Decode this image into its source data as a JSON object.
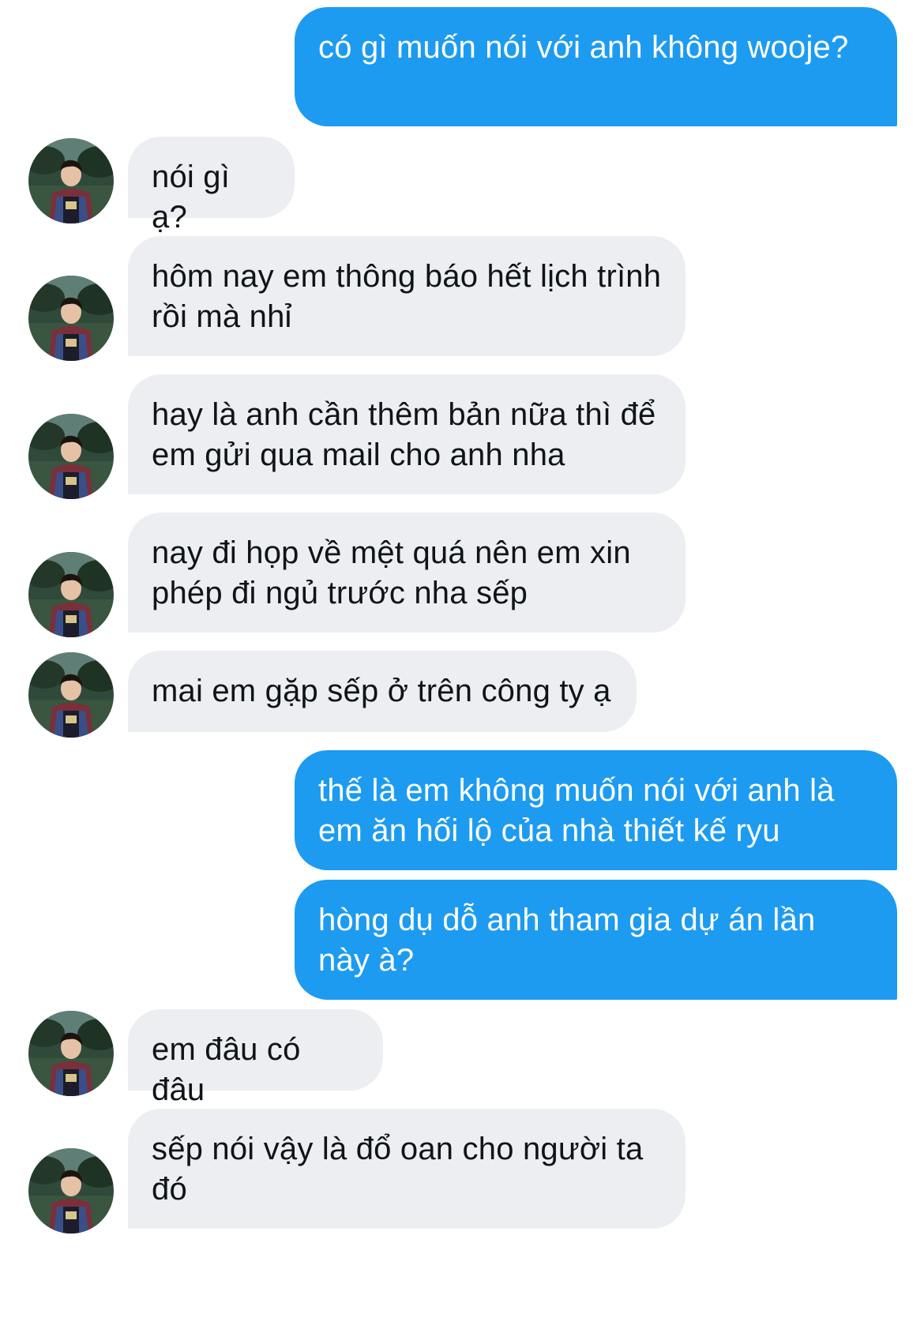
{
  "conversation": {
    "messages": [
      {
        "sender": "me",
        "text": "có gì muốn nói với anh không wooje?"
      },
      {
        "sender": "them",
        "text": "nói gì ạ?"
      },
      {
        "sender": "them",
        "text": "hôm nay em thông báo hết lịch trình rồi mà nhỉ"
      },
      {
        "sender": "them",
        "text": "hay là anh cần thêm bản nữa thì để em gửi qua mail cho anh nha"
      },
      {
        "sender": "them",
        "text": "nay đi họp về mệt quá nên em xin phép đi ngủ trước nha sếp"
      },
      {
        "sender": "them",
        "text": "mai em gặp sếp ở trên công ty ạ"
      },
      {
        "sender": "me",
        "text": "thế là em không muốn nói với anh là em ăn hối lộ của nhà thiết kế ryu"
      },
      {
        "sender": "me",
        "text": "hòng dụ dỗ anh tham gia dự án lần này à?"
      },
      {
        "sender": "them",
        "text": "em đâu có đâu"
      },
      {
        "sender": "them",
        "text": "sếp nói vậy là đổ oan cho người ta đó"
      }
    ]
  },
  "colors": {
    "sent_bubble": "#1d9bf0",
    "received_bubble": "#eceef1",
    "sent_text": "#ffffff",
    "received_text": "#0f1419"
  },
  "icons": {
    "avatar": "contact-avatar-photo"
  }
}
